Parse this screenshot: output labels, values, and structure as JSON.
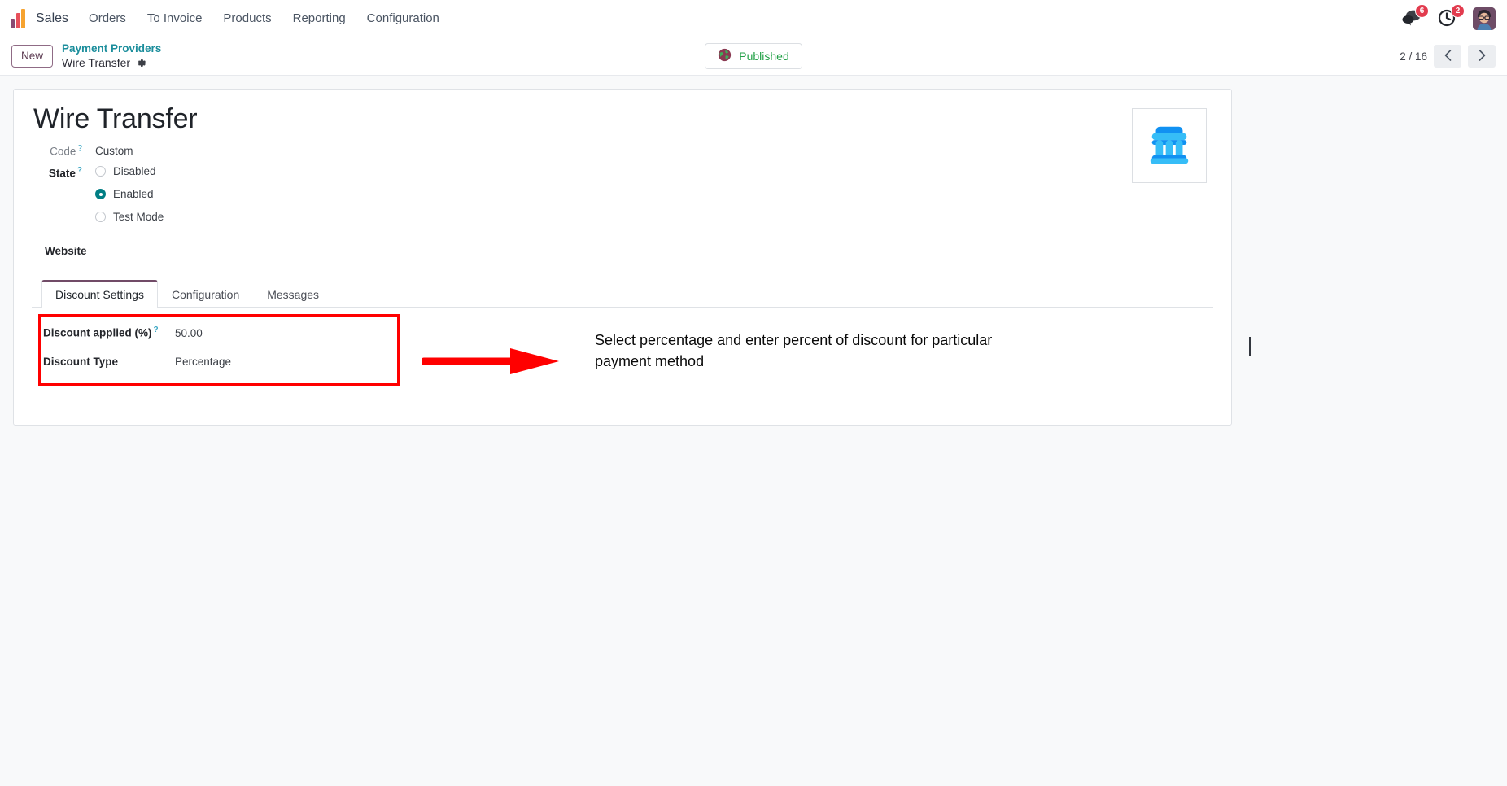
{
  "navbar": {
    "logo_icon": "sales-bar-chart-logo",
    "app_name": "Sales",
    "menu_items": [
      {
        "label": "Orders"
      },
      {
        "label": "To Invoice"
      },
      {
        "label": "Products"
      },
      {
        "label": "Reporting"
      },
      {
        "label": "Configuration"
      }
    ],
    "messages_icon": "messages-bubble-icon",
    "messages_count": "6",
    "activities_icon": "activities-clock-icon",
    "activities_count": "2",
    "avatar_icon": "user-avatar"
  },
  "control_panel": {
    "new_label": "New",
    "breadcrumb_parent": "Payment Providers",
    "breadcrumb_current": "Wire Transfer",
    "settings_icon": "gear-icon",
    "published_label": "Published",
    "published_icon": "globe-icon",
    "published_color": "#24a148",
    "pager_text": "2 / 16",
    "prev_icon": "chevron-left-icon",
    "next_icon": "chevron-right-icon"
  },
  "form": {
    "title": "Wire Transfer",
    "logo_icon": "bank-building-icon",
    "fields": {
      "code_label": "Code",
      "code_help": "?",
      "code_value": "Custom",
      "state_label": "State",
      "state_help": "?",
      "state_options": [
        {
          "label": "Disabled",
          "selected": false
        },
        {
          "label": "Enabled",
          "selected": true
        },
        {
          "label": "Test Mode",
          "selected": false
        }
      ],
      "website_label": "Website",
      "website_value": ""
    }
  },
  "notebook": {
    "tabs": [
      {
        "label": "Discount Settings",
        "active": true
      },
      {
        "label": "Configuration",
        "active": false
      },
      {
        "label": "Messages",
        "active": false
      }
    ],
    "discount_settings": {
      "discount_applied_label": "Discount applied (%)",
      "discount_applied_help": "?",
      "discount_applied_value": "50.00",
      "discount_type_label": "Discount Type",
      "discount_type_value": "Percentage"
    }
  },
  "annotation": {
    "text": "Select percentage and enter percent of discount for particular payment method",
    "highlight_color": "#ff0000",
    "arrow_color": "#ff0000"
  }
}
